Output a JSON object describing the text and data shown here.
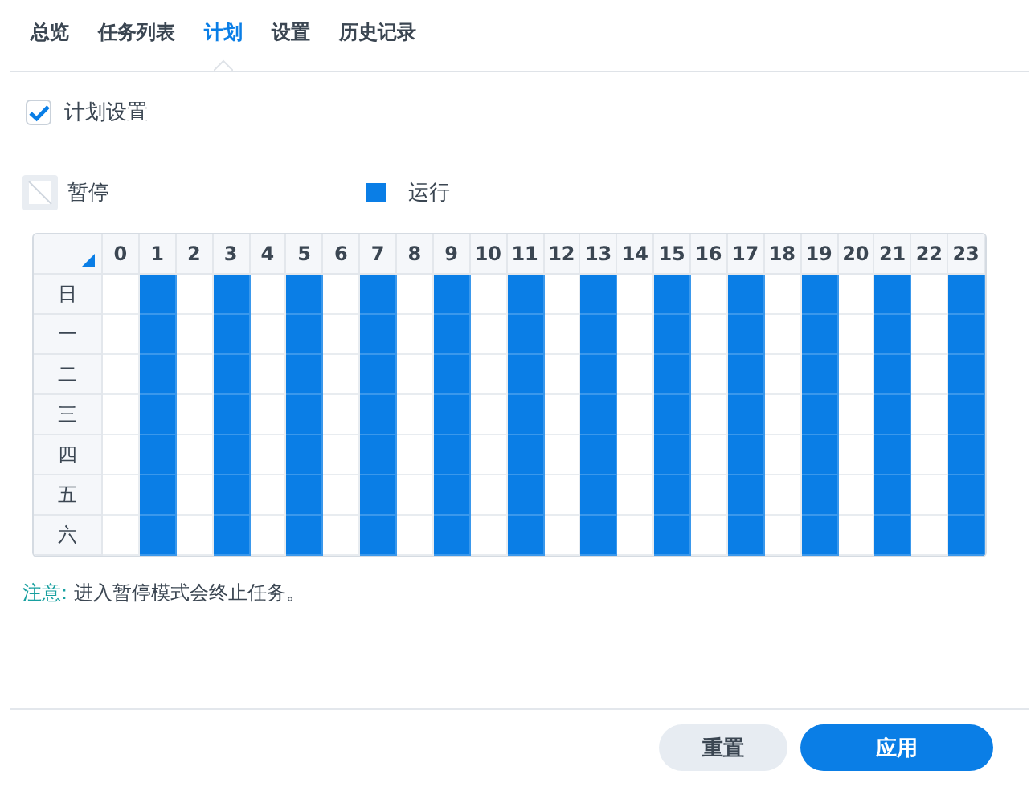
{
  "tabs": [
    {
      "label": "总览",
      "selected": false
    },
    {
      "label": "任务列表",
      "selected": false
    },
    {
      "label": "计划",
      "selected": true
    },
    {
      "label": "设置",
      "selected": false
    },
    {
      "label": "历史记录",
      "selected": false
    }
  ],
  "schedule_enabled": {
    "label": "计划设置",
    "checked": true
  },
  "legend": [
    {
      "kind": "pause",
      "label": "暂停"
    },
    {
      "kind": "run",
      "label": "运行"
    }
  ],
  "grid": {
    "hours": [
      "0",
      "1",
      "2",
      "3",
      "4",
      "5",
      "6",
      "7",
      "8",
      "9",
      "10",
      "11",
      "12",
      "13",
      "14",
      "15",
      "16",
      "17",
      "18",
      "19",
      "20",
      "21",
      "22",
      "23"
    ],
    "rows": [
      {
        "day": "日",
        "running": [
          false,
          true,
          false,
          true,
          false,
          true,
          false,
          true,
          false,
          true,
          false,
          true,
          false,
          true,
          false,
          true,
          false,
          true,
          false,
          true,
          false,
          true,
          false,
          true
        ]
      },
      {
        "day": "一",
        "running": [
          false,
          true,
          false,
          true,
          false,
          true,
          false,
          true,
          false,
          true,
          false,
          true,
          false,
          true,
          false,
          true,
          false,
          true,
          false,
          true,
          false,
          true,
          false,
          true
        ]
      },
      {
        "day": "二",
        "running": [
          false,
          true,
          false,
          true,
          false,
          true,
          false,
          true,
          false,
          true,
          false,
          true,
          false,
          true,
          false,
          true,
          false,
          true,
          false,
          true,
          false,
          true,
          false,
          true
        ]
      },
      {
        "day": "三",
        "running": [
          false,
          true,
          false,
          true,
          false,
          true,
          false,
          true,
          false,
          true,
          false,
          true,
          false,
          true,
          false,
          true,
          false,
          true,
          false,
          true,
          false,
          true,
          false,
          true
        ]
      },
      {
        "day": "四",
        "running": [
          false,
          true,
          false,
          true,
          false,
          true,
          false,
          true,
          false,
          true,
          false,
          true,
          false,
          true,
          false,
          true,
          false,
          true,
          false,
          true,
          false,
          true,
          false,
          true
        ]
      },
      {
        "day": "五",
        "running": [
          false,
          true,
          false,
          true,
          false,
          true,
          false,
          true,
          false,
          true,
          false,
          true,
          false,
          true,
          false,
          true,
          false,
          true,
          false,
          true,
          false,
          true,
          false,
          true
        ]
      },
      {
        "day": "六",
        "running": [
          false,
          true,
          false,
          true,
          false,
          true,
          false,
          true,
          false,
          true,
          false,
          true,
          false,
          true,
          false,
          true,
          false,
          true,
          false,
          true,
          false,
          true,
          false,
          true
        ]
      }
    ]
  },
  "note": {
    "label": "注意:",
    "text": "进入暂停模式会终止任务。"
  },
  "buttons": [
    {
      "kind": "secondary",
      "label": "重置"
    },
    {
      "kind": "primary",
      "label": "应用"
    }
  ]
}
